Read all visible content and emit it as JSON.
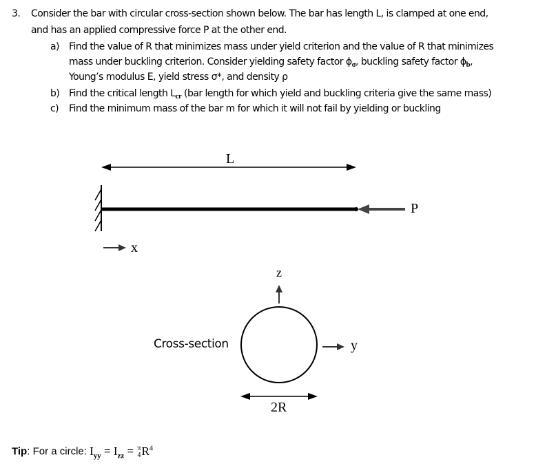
{
  "problem": {
    "number": "3.",
    "intro_line1": "Consider the bar with circular cross-section shown below. The bar has length L, is clamped at one end,",
    "intro_line2": "and has an applied compressive force P at the other end.",
    "parts": [
      {
        "label": "a)",
        "lines": [
          "Find the value of R that minimizes mass under yield criterion and the value of R that minimizes",
          "mass under buckling criterion. Consider yielding safety factor ϕ",
          "Young’s modulus E, yield stress σ*, and density ρ"
        ],
        "phi_sigma_sub": "σ",
        "mid_text": ", buckling safety factor ϕ",
        "phi_b_sub": "b",
        "end_text": ","
      },
      {
        "label": "b)",
        "before": "Find the critical length L",
        "sub": "cr",
        "after": " (bar length for which yield and buckling criteria give the same mass)"
      },
      {
        "label": "c)",
        "text": "Find the minimum mass of the bar m for which it will not fail by yielding or buckling"
      }
    ]
  },
  "diagram": {
    "length_label": "L",
    "force_label": "P",
    "x_axis_label": "x",
    "z_axis_label": "z",
    "y_axis_label": "y",
    "cross_section_label": "Cross-section",
    "diameter_label": "2R"
  },
  "tip": {
    "bold": "Tip",
    "text": ": For a circle: ",
    "formula_i1": "I",
    "sub_yy": "yy",
    "eq1": " = ",
    "formula_i2": "I",
    "sub_zz": "zz",
    "eq2": " = ",
    "frac_num": "π",
    "frac_den": "4",
    "r": "R",
    "r_exp": "4"
  }
}
